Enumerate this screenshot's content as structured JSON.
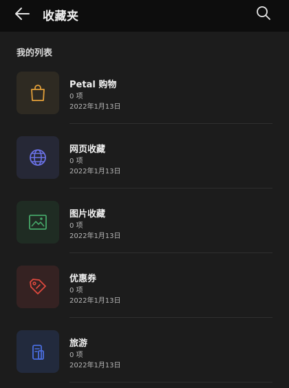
{
  "header": {
    "title": "收藏夹",
    "back_icon": "arrow-left-icon",
    "search_icon": "search-icon"
  },
  "section": {
    "title": "我的列表"
  },
  "items": [
    {
      "name": "Petal 购物",
      "count": "0 项",
      "date": "2022年1月13日",
      "icon": "shopping-bag-icon",
      "tile_color": "#2e2a22",
      "icon_color": "#e5a13a"
    },
    {
      "name": "网页收藏",
      "count": "0 项",
      "date": "2022年1月13日",
      "icon": "globe-icon",
      "tile_color": "#262836",
      "icon_color": "#6b72e8"
    },
    {
      "name": "图片收藏",
      "count": "0 项",
      "date": "2022年1月13日",
      "icon": "image-icon",
      "tile_color": "#1f2c23",
      "icon_color": "#46a86a"
    },
    {
      "name": "优惠券",
      "count": "0 项",
      "date": "2022年1月13日",
      "icon": "tag-icon",
      "tile_color": "#352222",
      "icon_color": "#e0493e"
    },
    {
      "name": "旅游",
      "count": "0 项",
      "date": "2022年1月13日",
      "icon": "luggage-icon",
      "tile_color": "#222a3d",
      "icon_color": "#4a6ee0"
    }
  ]
}
